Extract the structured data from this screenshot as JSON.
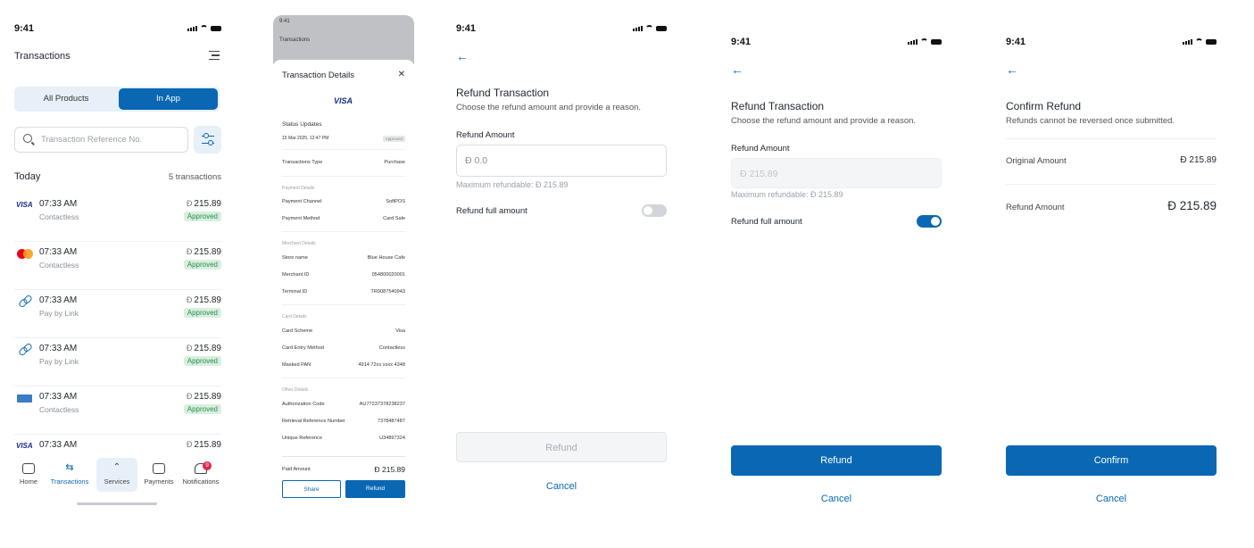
{
  "status_time": "9:41",
  "screen1": {
    "title": "Transactions",
    "segments": [
      "All Products",
      "In App"
    ],
    "search_placeholder": "Transaction Reference No.",
    "section": "Today",
    "count": "5 transactions",
    "rows": [
      {
        "icon": "visa-icon",
        "time": "07:33 AM",
        "method": "Contactless",
        "amount": "215.89",
        "status": "Approved"
      },
      {
        "icon": "mastercard-icon",
        "time": "07:33 AM",
        "method": "Contactless",
        "amount": "215.89",
        "status": "Approved"
      },
      {
        "icon": "link-icon",
        "time": "07:33 AM",
        "method": "Pay by Link",
        "amount": "215.89",
        "status": "Approved"
      },
      {
        "icon": "link-icon",
        "time": "07:33 AM",
        "method": "Pay by Link",
        "amount": "215.89",
        "status": "Approved"
      },
      {
        "icon": "amex-icon",
        "time": "07:33 AM",
        "method": "Contactless",
        "amount": "215.89",
        "status": "Approved"
      },
      {
        "icon": "visa-icon",
        "time": "07:33 AM",
        "method": "",
        "amount": "215.89",
        "status": ""
      }
    ],
    "currency_symbol": "Ð",
    "tabs": [
      "Home",
      "Transactions",
      "Services",
      "Payments",
      "Notifications"
    ],
    "notification_count": "9"
  },
  "screen2": {
    "bg_title": "Transactions",
    "title": "Transaction Details",
    "brand": "VISA",
    "status_updates": "Status Updates",
    "date": "15 Mar 2025, 12:47 PM",
    "status": "Approved",
    "transactions_type_label": "Transactions Type",
    "transactions_type": "Purchase",
    "payment_details": "Payment Details",
    "payment_channel_label": "Payment Channel",
    "payment_channel": "SoftPOS",
    "payment_method_label": "Payment Method",
    "payment_method": "Card Sale",
    "merchant_details": "Merchant Details",
    "store_name_label": "Store name",
    "store_name": "Blue House Cafe",
    "merchant_id_label": "Merchant ID",
    "merchant_id": "054800020001",
    "terminal_id_label": "Terminal ID",
    "terminal_id": "TR9087540943",
    "card_details": "Card Details",
    "card_scheme_label": "Card Scheme",
    "card_scheme": "Visa",
    "card_entry_label": "Card Entry Method",
    "card_entry": "Contactless",
    "masked_pan_label": "Masked PAN",
    "masked_pan": "4914 72xx xxxx 4348",
    "other_details": "Other Details",
    "auth_code_label": "Authorization Code",
    "auth_code": "AU77237378238237",
    "rrn_label": "Retrieval Reference Number",
    "rrn": "7378487487",
    "unique_ref_label": "Unique Reference",
    "unique_ref": "U34897324",
    "paid_amount_label": "Paid Amount",
    "paid_amount": "Ð 215.89",
    "share": "Share",
    "refund": "Refund"
  },
  "screen3": {
    "title": "Refund Transaction",
    "subtitle": "Choose the refund amount and provide a reason.",
    "amount_label": "Refund Amount",
    "amount_value": "Ð 0.0",
    "max": "Maximum refundable: Ð 215.89",
    "full_label": "Refund full amount",
    "full_on": false,
    "button": "Refund",
    "cancel": "Cancel"
  },
  "screen4": {
    "title": "Refund Transaction",
    "subtitle": "Choose the refund amount and provide a reason.",
    "amount_label": "Refund Amount",
    "amount_value": "Ð 215.89",
    "max": "Maximum refundable: Ð 215.89",
    "full_label": "Refund full amount",
    "full_on": true,
    "button": "Refund",
    "cancel": "Cancel"
  },
  "screen5": {
    "title": "Confirm Refund",
    "subtitle": "Refunds cannot be reversed once submitted.",
    "original_label": "Original Amount",
    "original_value": "Ð 215.89",
    "refund_label": "Refund Amount",
    "refund_value": "Ð 215.89",
    "button": "Confirm",
    "cancel": "Cancel"
  },
  "colors": {
    "primary": "#0a67b3",
    "approved_bg": "#d7f0df",
    "approved_text": "#2f8a4e",
    "badge_red": "#e02a4a"
  }
}
